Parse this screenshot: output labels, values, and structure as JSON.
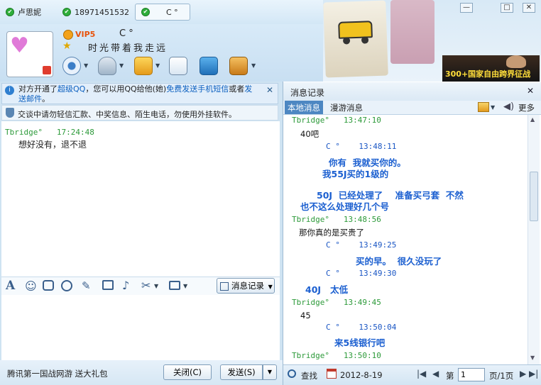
{
  "window": {
    "tabs": [
      {
        "name": "卢思妮",
        "active": false
      },
      {
        "name": "18971451532",
        "active": false
      },
      {
        "name": "C °",
        "active": true
      }
    ],
    "buttons": {
      "minimize": "—",
      "maximize": "□",
      "close": "✕"
    }
  },
  "contact": {
    "vip_label": "VIP5",
    "nickname": "C °",
    "signature": "时光带着我走远",
    "avatar_glyph": "♥"
  },
  "banner": {
    "text": "300+国家自由跨界征战"
  },
  "notice": {
    "line1_a": "对方开通了",
    "line1_link1": "超级QQ",
    "line1_b": "，您可以用QQ给他(她)",
    "line1_link2": "免费发送手机短信",
    "line1_c": "或者",
    "line1_link3": "发送邮件",
    "line1_d": "。",
    "line2": "交谈中请勿轻信汇款、中奖信息、陌生电话，勿使用外挂软件。"
  },
  "chat": [
    {
      "sender": "Tbridge°",
      "time": "17:24:48",
      "text": "想好没有，退不退"
    }
  ],
  "format_toolbar": {
    "history_button": "消息记录"
  },
  "bottom": {
    "ad": "腾讯第一国战网游 送大礼包",
    "close_btn": "关闭(C)",
    "send_btn": "发送(S)"
  },
  "history": {
    "title": "消息记录",
    "tab_local": "本地消息",
    "tab_roam": "漫游消息",
    "more": "更多",
    "messages": [
      {
        "kind": "header",
        "who": "Tbridge°",
        "time": "13:47:10",
        "self": false
      },
      {
        "kind": "text",
        "text": "40吧",
        "self": false
      },
      {
        "kind": "header",
        "who": "C °",
        "time": "13:48:11",
        "self": true
      },
      {
        "kind": "text",
        "text": "你有  我就买你的。",
        "self": true
      },
      {
        "kind": "text",
        "text": "我55J买的1级的",
        "self": true
      },
      {
        "kind": "text",
        "text": "50J  已经处理了    准备买弓套  不然",
        "self": true
      },
      {
        "kind": "text",
        "text": "也不这么处理好几个号",
        "self": true
      },
      {
        "kind": "header",
        "who": "Tbridge°",
        "time": "13:48:56",
        "self": false
      },
      {
        "kind": "text",
        "text": "那你真的是买贵了",
        "self": false
      },
      {
        "kind": "header",
        "who": "C °",
        "time": "13:49:25",
        "self": true
      },
      {
        "kind": "text",
        "text": "买的早。  很久没玩了",
        "self": true
      },
      {
        "kind": "header",
        "who": "C °",
        "time": "13:49:30",
        "self": true
      },
      {
        "kind": "text",
        "text": "40J   太低",
        "self": true
      },
      {
        "kind": "header",
        "who": "Tbridge°",
        "time": "13:49:45",
        "self": false
      },
      {
        "kind": "text",
        "text": "45",
        "self": false
      },
      {
        "kind": "header",
        "who": "C °",
        "time": "13:50:04",
        "self": true
      },
      {
        "kind": "text",
        "text": "来5线银行吧",
        "self": true
      },
      {
        "kind": "header",
        "who": "Tbridge°",
        "time": "13:50:10",
        "self": false
      }
    ],
    "footer": {
      "search": "查找",
      "date": "2012-8-19",
      "page_prefix": "第",
      "page_value": "1",
      "page_suffix": "页/1页"
    }
  }
}
